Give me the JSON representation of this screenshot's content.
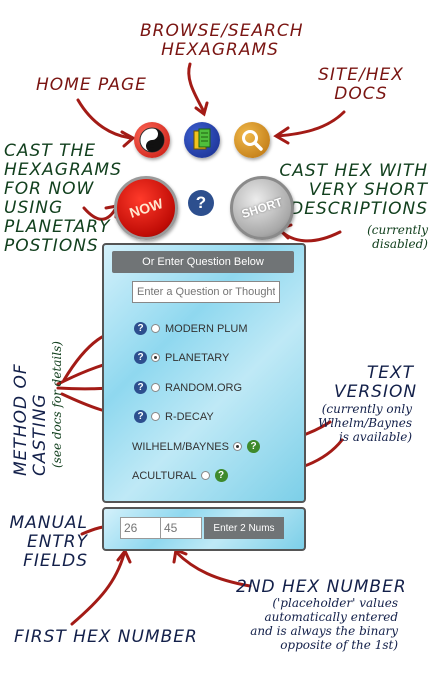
{
  "annotations": {
    "browse": "BROWSE/SEARCH HEXAGRAMS",
    "home": "HOME PAGE",
    "docs": "SITE/HEX DOCS",
    "cast_now": "CAST THE HEXAGRAMS FOR NOW USING PLANETARY POSTIONS",
    "cast_short": "CAST HEX WITH VERY SHORT DESCRIPTIONS",
    "cast_short_note": "(currently disabled)",
    "method": "METHOD OF CASTING",
    "method_note": "(see docs for details)",
    "text_version": "TEXT VERSION",
    "text_version_note": "(currently only Wlhelm/Baynes is available)",
    "manual": "MANUAL ENTRY FIELDS",
    "second_hex": "2ND HEX NUMBER",
    "second_hex_note": "('placeholder' values automatically entered and is always the binary opposite of the 1st)",
    "first_hex": "FIRST HEX NUMBER"
  },
  "buttons": {
    "now": "NOW",
    "short": "SHORT",
    "help": "?"
  },
  "panel": {
    "header": "Or Enter Question Below",
    "question_placeholder": "Enter a Question or Thought",
    "methods": [
      {
        "label": "MODERN PLUM",
        "selected": false
      },
      {
        "label": "PLANETARY",
        "selected": true
      },
      {
        "label": "RANDOM.ORG",
        "selected": false
      },
      {
        "label": "R-DECAY",
        "selected": false
      }
    ],
    "versions": [
      {
        "label": "WILHELM/BAYNES",
        "selected": true
      },
      {
        "label": "ACULTURAL",
        "selected": false
      }
    ]
  },
  "manual_entry": {
    "hex1_placeholder": "26",
    "hex2_placeholder": "45",
    "button": "Enter 2 Nums"
  },
  "colors": {
    "annotation": "#7a1512",
    "annotation_green": "#12401e",
    "panel": "#8fd8ef",
    "header": "#707476"
  }
}
